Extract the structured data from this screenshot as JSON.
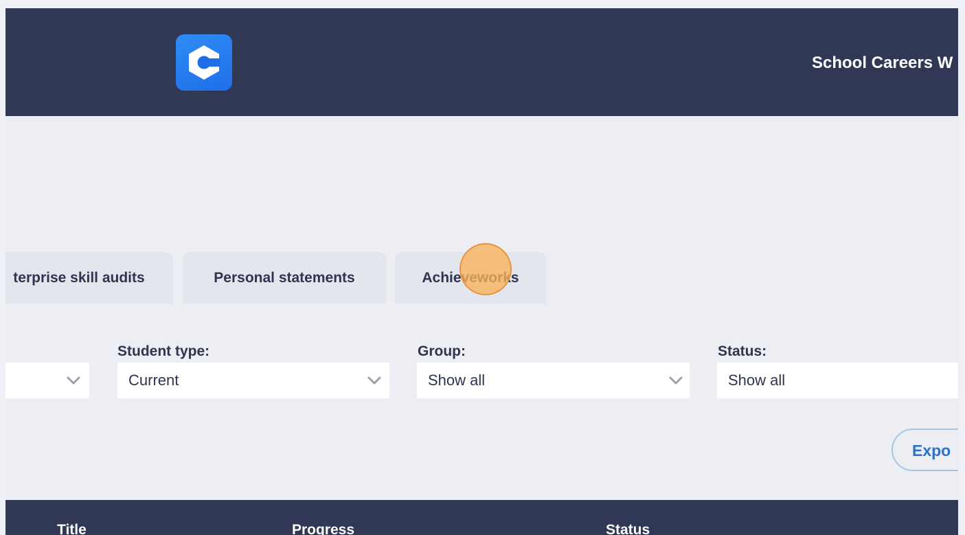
{
  "header": {
    "logo_icon": "c-hexagon-logo-icon",
    "school_name": "School Careers W"
  },
  "tabs": [
    {
      "label": "Enterprise skill audits",
      "visible_text": "terprise skill audits"
    },
    {
      "label": "Personal statements"
    },
    {
      "label": "Achieveworks"
    }
  ],
  "filters": {
    "first": {
      "value": "",
      "icon": "chevron-down-icon"
    },
    "student_type": {
      "label": "Student type:",
      "value": "Current",
      "icon": "chevron-down-icon"
    },
    "group": {
      "label": "Group:",
      "value": "Show all",
      "icon": "chevron-down-icon"
    },
    "status": {
      "label": "Status:",
      "value": "Show all"
    }
  },
  "export_button": {
    "label": "Expo"
  },
  "table": {
    "columns": [
      "Title",
      "Progress",
      "Status"
    ]
  },
  "colors": {
    "navy": "#313856",
    "background": "#eceef3",
    "accent_blue": "#2e71c8",
    "logo_blue": "#1f6ee8",
    "cursor_highlight": "#f8b25a"
  }
}
